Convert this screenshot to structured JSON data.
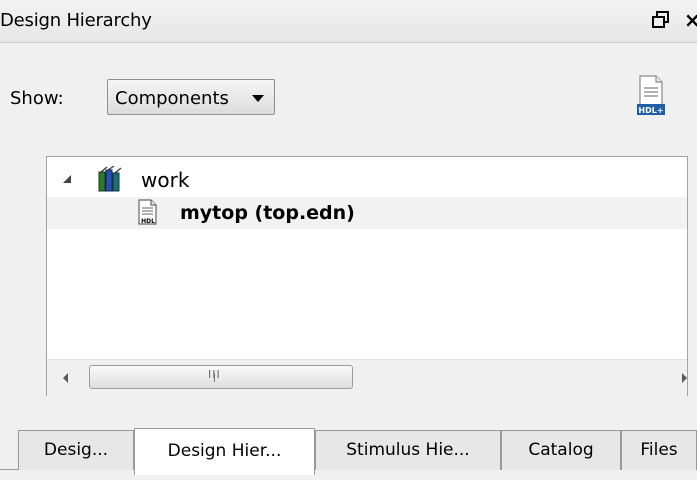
{
  "panel": {
    "title": "Design Hierarchy",
    "restore_icon": "restore-window-icon",
    "close_glyph": "×"
  },
  "toolbar": {
    "show_label": "Show:",
    "show_select": {
      "value": "Components",
      "options": [
        "Components"
      ]
    },
    "hdl_button": {
      "icon": "new-hdl-file-icon",
      "icon_text": "HDL+"
    }
  },
  "tree": {
    "items": [
      {
        "label": "work",
        "icon": "library-books-icon",
        "expanded": true
      },
      {
        "label": "mytop (top.edn)",
        "icon": "hdl-file-icon",
        "icon_text": "HDL",
        "selected": true
      }
    ],
    "scrollbar": {
      "grip": "III"
    }
  },
  "tabs": [
    {
      "label": "Desig...",
      "active": false
    },
    {
      "label": "Design Hier...",
      "active": true
    },
    {
      "label": "Stimulus Hie...",
      "active": false
    },
    {
      "label": "Catalog",
      "active": false
    },
    {
      "label": "Files",
      "active": false
    }
  ],
  "colors": {
    "hdl_blue": "#1f5fa8",
    "tree_bg": "#ffffff",
    "panel_bg": "#f0f0f0"
  }
}
